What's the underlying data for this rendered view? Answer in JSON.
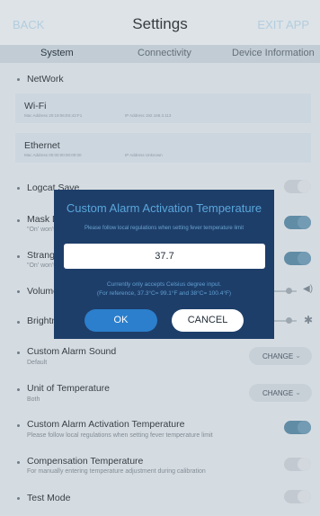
{
  "header": {
    "back": "BACK",
    "title": "Settings",
    "exit": "EXIT APP"
  },
  "tabs": [
    "System",
    "Connectivity",
    "Device Information"
  ],
  "network": {
    "label": "NetWork",
    "wifi": {
      "title": "Wi-Fi",
      "mac": "Mac Address 20:19:06:E5:42:F1",
      "ip": "IP Address 192.168.3.113"
    },
    "ethernet": {
      "title": "Ethernet",
      "mac": "Mac Address 00:00:00:00:00:00",
      "ip": "IP Address Unknown"
    }
  },
  "settings": {
    "logcat": {
      "label": "Logcat Save",
      "on": false
    },
    "mask": {
      "label": "Mask Detection",
      "sub": "\"On' won't...",
      "on": true
    },
    "stranger": {
      "label": "Stranger Detection",
      "sub": "\"On' won't...",
      "on": true
    },
    "volume": {
      "label": "Volume",
      "level": 0.92
    },
    "brightness": {
      "label": "Brightness",
      "level": 0.92
    },
    "alarm_sound": {
      "label": "Custom Alarm Sound",
      "sub": "Default",
      "button": "CHANGE"
    },
    "unit": {
      "label": "Unit of Temperature",
      "sub": "Both",
      "button": "CHANGE"
    },
    "alarm_temp": {
      "label": "Custom Alarm Activation Temperature",
      "sub": "Please follow local regulations when setting fever temperature limit",
      "on": true
    },
    "compensation": {
      "label": "Compensation Temperature",
      "sub": "For manually entering temperature adjustment during calibration",
      "on": false
    },
    "test_mode": {
      "label": "Test Mode",
      "on": false
    }
  },
  "dialog": {
    "title": "Custom Alarm Activation Temperature",
    "hint": "Please follow local regulations when setting fever temperature limit",
    "value": "37.7",
    "note1": "Currently only accepts Celsius degree input.",
    "note2": "(For reference, 37.3°C= 99.1°F and 38°C= 100.4°F)",
    "ok": "OK",
    "cancel": "CANCEL"
  }
}
